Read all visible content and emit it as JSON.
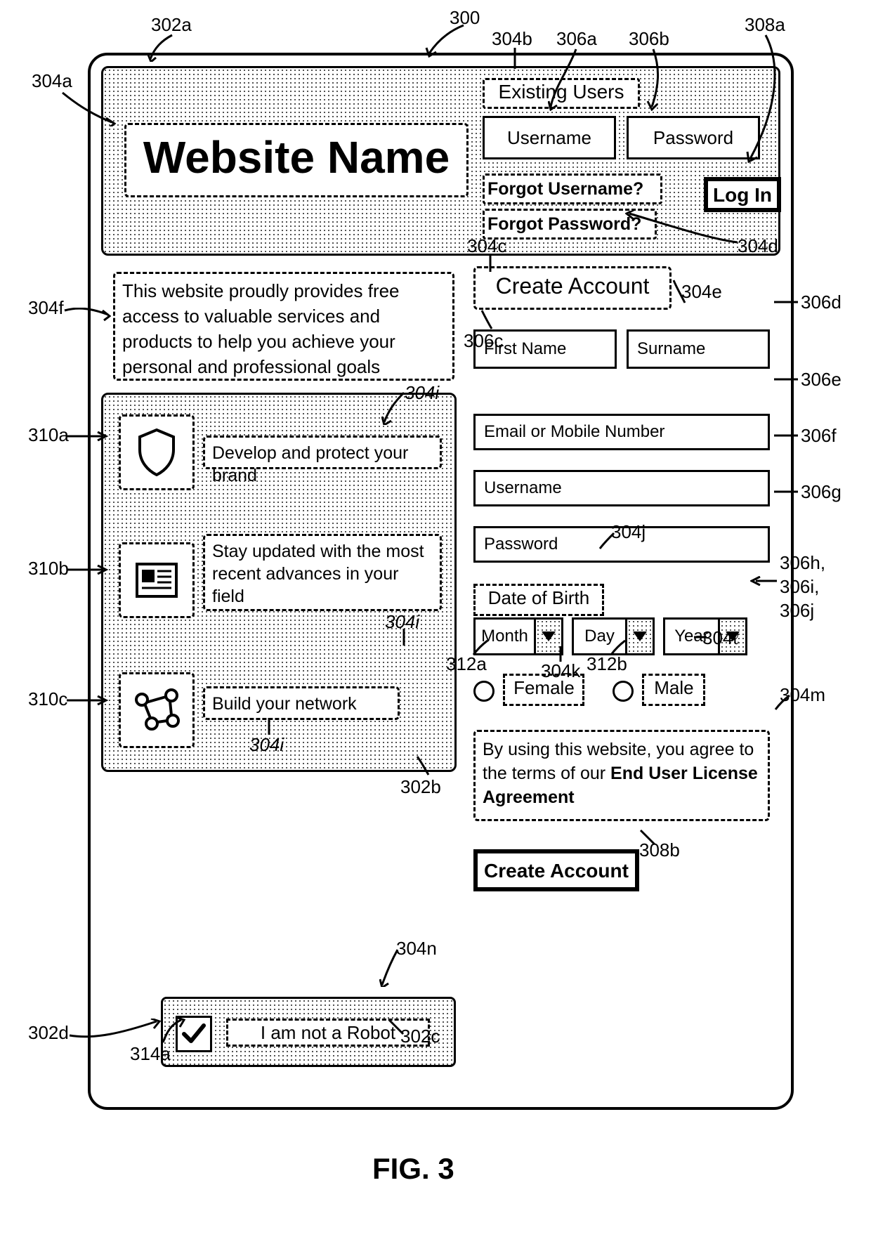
{
  "figure_label": "FIG. 3",
  "site_name": "Website Name",
  "existing_users_label": "Existing Users",
  "username_placeholder": "Username",
  "password_placeholder": "Password",
  "login_label": "Log In",
  "forgot_username_label": "Forgot Username?",
  "forgot_password_label": "Forgot Password?",
  "intro_text": "This website proudly provides free access to valuable services and products to help you achieve your personal and professional goals",
  "features": [
    "Develop and protect your brand",
    "Stay updated with the most recent advances in your field",
    "Build your network"
  ],
  "captcha_label": "I am not a Robot",
  "create_account_heading": "Create Account",
  "first_name_ph": "First Name",
  "surname_ph": "Surname",
  "email_ph": "Email or Mobile Number",
  "username_signup_ph": "Username",
  "password_signup_ph": "Password",
  "dob_label": "Date of Birth",
  "dob": {
    "month": "Month",
    "day": "Day",
    "year": "Year"
  },
  "gender": {
    "female": "Female",
    "male": "Male"
  },
  "eula_prefix": "By using this website, you agree to the terms of our ",
  "eula_bold": "End User License Agreement",
  "create_account_btn": "Create Account",
  "refs": {
    "r300": "300",
    "r302a": "302a",
    "r302b": "302b",
    "r302c": "302c",
    "r302d": "302d",
    "r304a": "304a",
    "r304b": "304b",
    "r304c": "304c",
    "r304d": "304d",
    "r304e": "304e",
    "r304f": "304f",
    "r304i": "304i",
    "r304j": "304j",
    "r304k": "304k",
    "r304l": "304ℓ",
    "r304m": "304m",
    "r304n": "304n",
    "r306a": "306a",
    "r306b": "306b",
    "r306c": "306c",
    "r306d": "306d",
    "r306e": "306e",
    "r306f": "306f",
    "r306g": "306g",
    "r306h": "306h,",
    "r306i": "306i,",
    "r306j": "306j",
    "r308a": "308a",
    "r308b": "308b",
    "r310a": "310a",
    "r310b": "310b",
    "r310c": "310c",
    "r312a": "312a",
    "r312b": "312b",
    "r314a": "314a"
  }
}
